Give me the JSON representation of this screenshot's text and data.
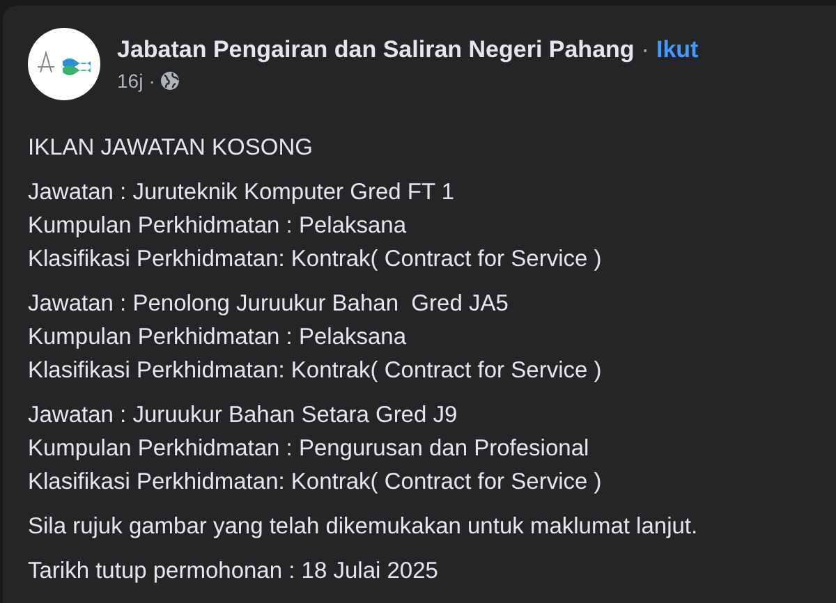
{
  "post": {
    "author": "Jabatan Pengairan dan Saliran Negeri Pahang",
    "separator": "·",
    "follow": "Ikut",
    "time": "16j",
    "time_separator": "·",
    "paragraphs": [
      [
        "IKLAN JAWATAN KOSONG"
      ],
      [
        "Jawatan : Juruteknik Komputer Gred FT 1",
        "Kumpulan Perkhidmatan : Pelaksana",
        "Klasifikasi Perkhidmatan: Kontrak( Contract for Service )"
      ],
      [
        "Jawatan : Penolong Juruukur Bahan  Gred JA5",
        "Kumpulan Perkhidmatan : Pelaksana",
        "Klasifikasi Perkhidmatan: Kontrak( Contract for Service )"
      ],
      [
        "Jawatan : Juruukur Bahan Setara Gred J9",
        "Kumpulan Perkhidmatan : Pengurusan dan Profesional",
        "Klasifikasi Perkhidmatan: Kontrak( Contract for Service )"
      ],
      [
        "Sila rujuk gambar yang telah dikemukakan untuk maklumat lanjut."
      ],
      [
        "Tarikh tutup permohonan : 18 Julai 2025"
      ]
    ]
  }
}
